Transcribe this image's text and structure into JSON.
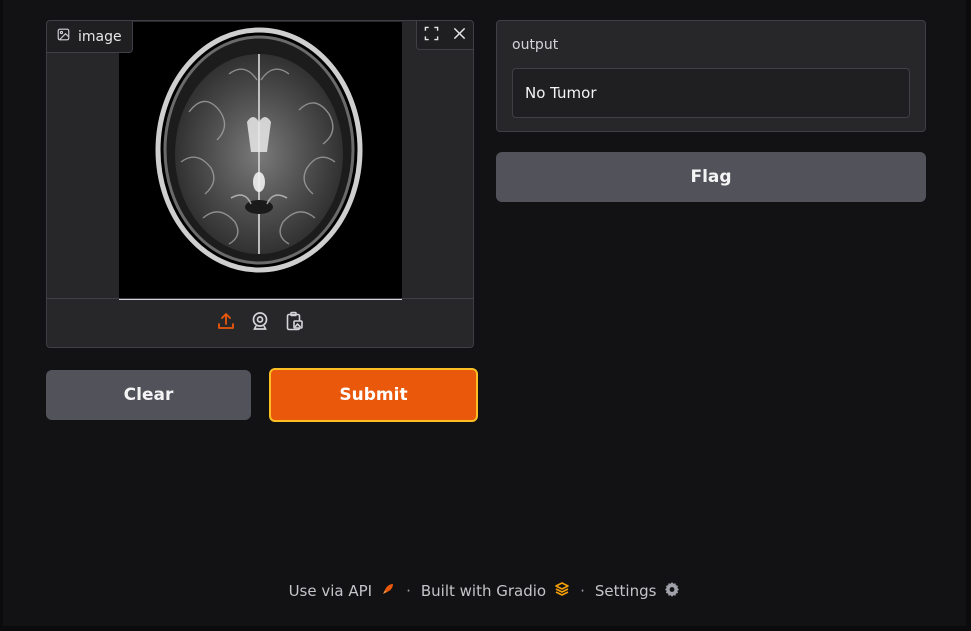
{
  "image_input": {
    "label": "image",
    "icons": {
      "label_icon": "image-icon",
      "fullscreen": "fullscreen-icon",
      "clear": "close-icon",
      "upload": "upload-icon",
      "webcam": "webcam-icon",
      "clipboard": "clipboard-icon"
    },
    "preview_alt": "brain MRI scan"
  },
  "buttons": {
    "clear": "Clear",
    "submit": "Submit",
    "flag": "Flag"
  },
  "output": {
    "label": "output",
    "value": "No Tumor"
  },
  "footer": {
    "api": "Use via API",
    "built_with": "Built with Gradio",
    "settings": "Settings",
    "separator": "·"
  },
  "colors": {
    "accent": "#ea580c",
    "accent_border": "#fbbf24",
    "secondary_button": "#52525b",
    "panel": "#27272a",
    "background": "#121214"
  }
}
